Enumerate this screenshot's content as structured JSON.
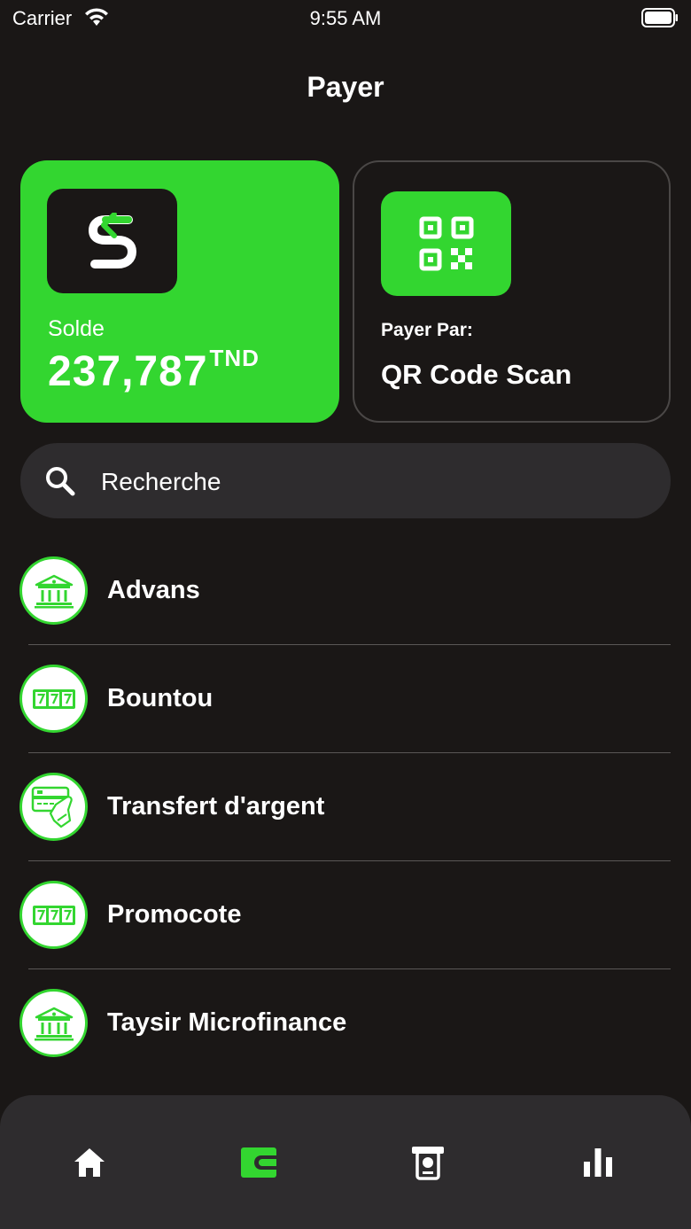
{
  "status": {
    "carrier": "Carrier",
    "time": "9:55 AM"
  },
  "page": {
    "title": "Payer"
  },
  "balance_card": {
    "label": "Solde",
    "value": "237,787",
    "currency": "TND",
    "logo_icon": "app-logo-icon"
  },
  "qr_card": {
    "label": "Payer Par:",
    "title": "QR Code Scan",
    "icon": "qr-code-icon"
  },
  "search": {
    "placeholder": "Recherche"
  },
  "list": [
    {
      "label": "Advans",
      "icon": "bank-icon"
    },
    {
      "label": "Bountou",
      "icon": "slot-777-icon"
    },
    {
      "label": "Transfert d'argent",
      "icon": "card-payment-icon"
    },
    {
      "label": "Promocote",
      "icon": "slot-777-icon"
    },
    {
      "label": "Taysir Microfinance",
      "icon": "bank-icon"
    }
  ],
  "tabs": [
    {
      "name": "home",
      "icon": "home-icon",
      "active": false
    },
    {
      "name": "wallet",
      "icon": "wallet-icon",
      "active": true
    },
    {
      "name": "pos",
      "icon": "pos-terminal-icon",
      "active": false
    },
    {
      "name": "stats",
      "icon": "bar-chart-icon",
      "active": false
    }
  ],
  "colors": {
    "accent": "#33d630",
    "background": "#1a1716",
    "surface": "#2e2c2e",
    "text": "#ffffff"
  }
}
